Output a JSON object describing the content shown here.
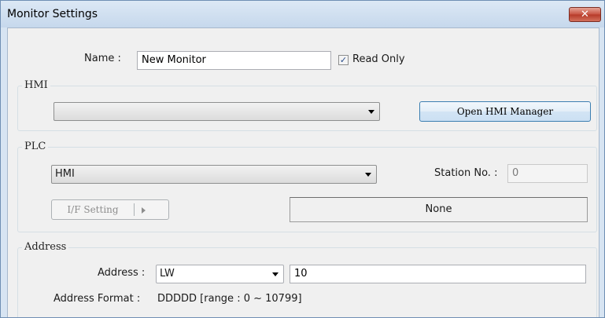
{
  "window": {
    "title": "Monitor Settings",
    "close_label": "✕"
  },
  "name_row": {
    "label": "Name :",
    "value": "New Monitor",
    "read_only_label": "Read Only",
    "read_only_checked": true
  },
  "hmi_group": {
    "title": "HMI",
    "selected": "",
    "open_manager_label": "Open HMI Manager"
  },
  "plc_group": {
    "title": "PLC",
    "selected": "HMI",
    "station_label": "Station No. :",
    "station_value": "0",
    "if_setting_label": "I/F Setting",
    "interface_value": "None"
  },
  "address_group": {
    "title": "Address",
    "address_label": "Address :",
    "device_type": "LW",
    "address_value": "10",
    "format_label": "Address Format :",
    "format_value": "DDDDD [range : 0 ~ 10799]"
  }
}
